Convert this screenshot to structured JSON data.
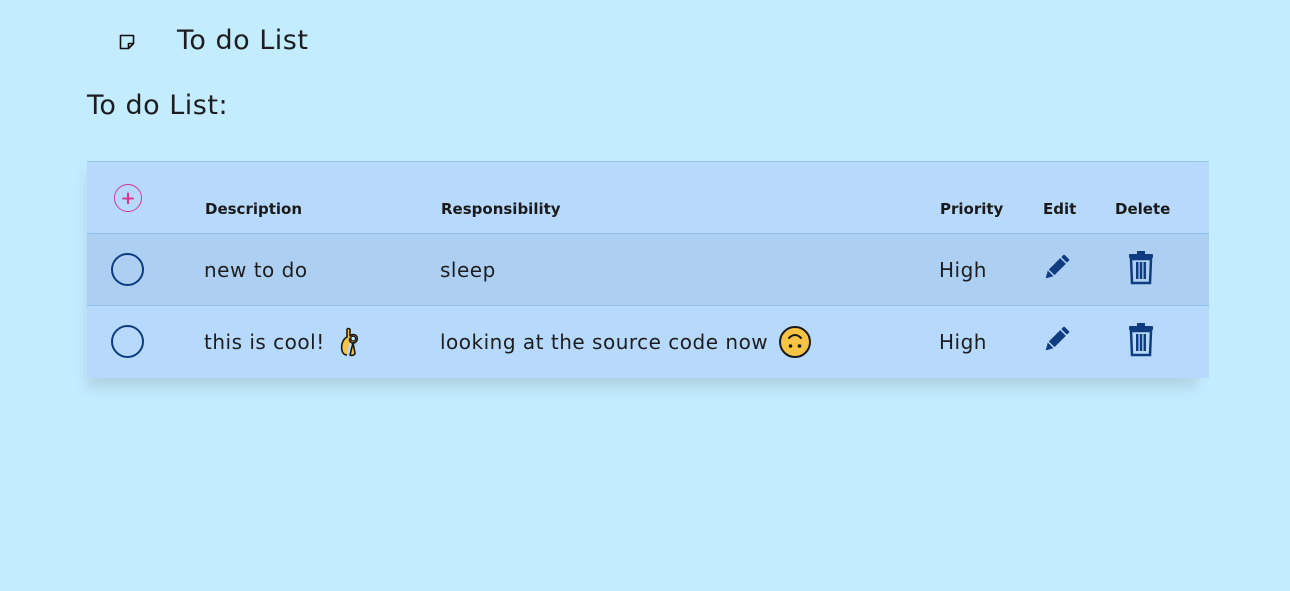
{
  "header": {
    "app_title": "To do List",
    "note_icon": "sticky-note-icon"
  },
  "page": {
    "heading": "To do List:"
  },
  "colors": {
    "background": "#c3ecfe",
    "table_header": "#b7dafc",
    "row_alt": "#add0f2",
    "accent_add": "#d63a8f",
    "icon_blue": "#0f3b80"
  },
  "table": {
    "add_icon": "plus-circle-icon",
    "columns": {
      "description": "Description",
      "responsibility": "Responsibility",
      "priority": "Priority",
      "edit": "Edit",
      "delete": "Delete"
    },
    "rows": [
      {
        "description": "new to do",
        "responsibility": "sleep",
        "priority": "High",
        "description_emoji": "",
        "responsibility_emoji": ""
      },
      {
        "description": "this is cool!",
        "responsibility": "looking at the source code now",
        "priority": "High",
        "description_emoji": "ok-hand-emoji",
        "responsibility_emoji": "upside-down-face-emoji"
      }
    ],
    "edit_icon": "pencil-icon",
    "delete_icon": "trash-icon"
  }
}
